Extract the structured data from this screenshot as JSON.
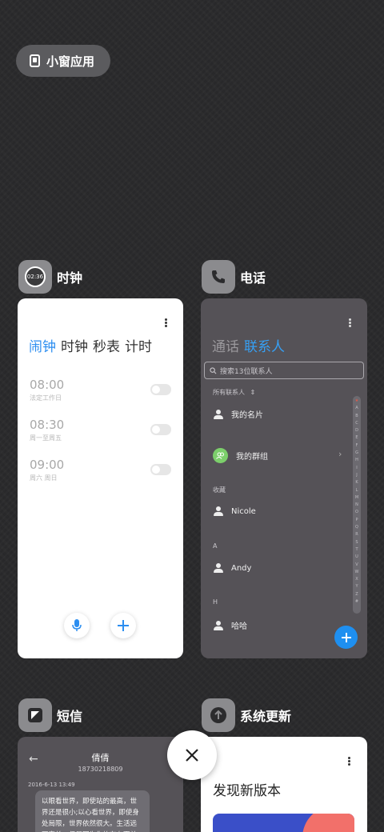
{
  "mini_window": {
    "label": "小窗应用"
  },
  "apps": {
    "clock": {
      "name": "时钟",
      "icon_time": "02:36",
      "tabs": [
        "闹钟",
        "时钟",
        "秒表",
        "计时"
      ],
      "active_tab": 0,
      "alarms": [
        {
          "time": "08:00",
          "repeat": "法定工作日",
          "enabled": false
        },
        {
          "time": "08:30",
          "repeat": "周一至周五",
          "enabled": false
        },
        {
          "time": "09:00",
          "repeat": "周六 周日",
          "enabled": false
        }
      ]
    },
    "phone": {
      "name": "电话",
      "tabs": [
        "通话",
        "联系人"
      ],
      "active_tab": 1,
      "search_placeholder": "搜索13位联系人",
      "all_contacts_label": "所有联系人",
      "my_card": "我的名片",
      "my_groups": "我的群组",
      "favorites_label": "收藏",
      "sections": [
        {
          "header": "",
          "name": "Nicole"
        },
        {
          "header": "A",
          "name": "Andy"
        },
        {
          "header": "H",
          "name": "哈哈"
        }
      ],
      "alphabet": [
        "★",
        "A",
        "B",
        "C",
        "D",
        "E",
        "F",
        "G",
        "H",
        "I",
        "J",
        "K",
        "L",
        "M",
        "N",
        "O",
        "P",
        "Q",
        "R",
        "S",
        "T",
        "U",
        "V",
        "W",
        "X",
        "Y",
        "Z",
        "#"
      ]
    },
    "sms": {
      "name": "短信",
      "contact_name": "倩倩",
      "contact_number": "18730218809",
      "timestamp": "2016-6-13 13:49",
      "message": "以眼看世界，即使站的最高，世界还是很小;以心看世界，即使身处局限，世界依然很大。生活远不完美，但是因为你的存在而美好"
    },
    "update": {
      "name": "系统更新",
      "headline": "发现新版本"
    }
  },
  "colors": {
    "accent_blue": "#2c8ef0",
    "background": "#2a2a2c",
    "group_green": "#7ccf6b",
    "update_banner_blue": "#3a4fc8",
    "update_banner_coral": "#f2706a"
  }
}
